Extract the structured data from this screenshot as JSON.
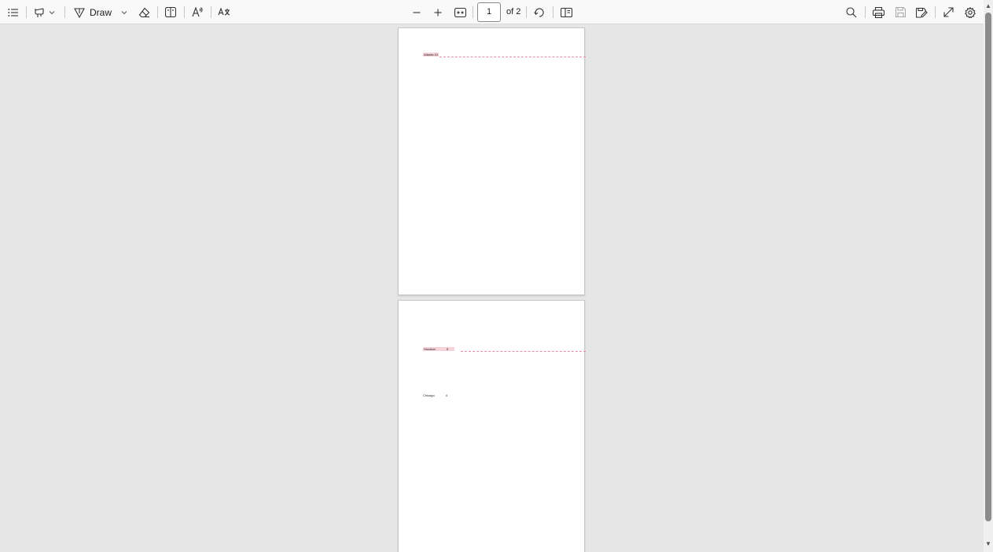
{
  "toolbar": {
    "draw_label": "Draw",
    "page_number": "1",
    "page_of": "of 2",
    "icons": {
      "contents": "list-icon",
      "highlight": "highlighter-icon",
      "draw": "pen-icon",
      "erase": "eraser-icon",
      "text_box": "text-box-icon",
      "read_aloud": "read-aloud-icon",
      "translate": "translate-icon",
      "zoom_out": "minus-icon",
      "zoom_in": "plus-icon",
      "fit": "fit-width-icon",
      "rotate": "rotate-icon",
      "page_view": "two-page-icon",
      "find": "search-icon",
      "print": "print-icon",
      "save": "save-icon",
      "save_as": "save-as-icon",
      "fullscreen": "expand-icon",
      "settings": "gear-icon"
    }
  },
  "document": {
    "pages": [
      {
        "rows": [
          {
            "city": "Atlanta",
            "value": "10",
            "highlighted": true
          }
        ]
      },
      {
        "rows": [
          {
            "city": "Houston",
            "value": "5",
            "highlighted": true
          },
          {
            "city": "Chicago",
            "value": "4",
            "highlighted": false
          }
        ]
      }
    ]
  },
  "colors": {
    "toolbar_bg": "#f9f9f9",
    "viewer_bg": "#e6e6e6",
    "highlight": "#f5d3d9",
    "revision_line": "#e58ea0"
  }
}
